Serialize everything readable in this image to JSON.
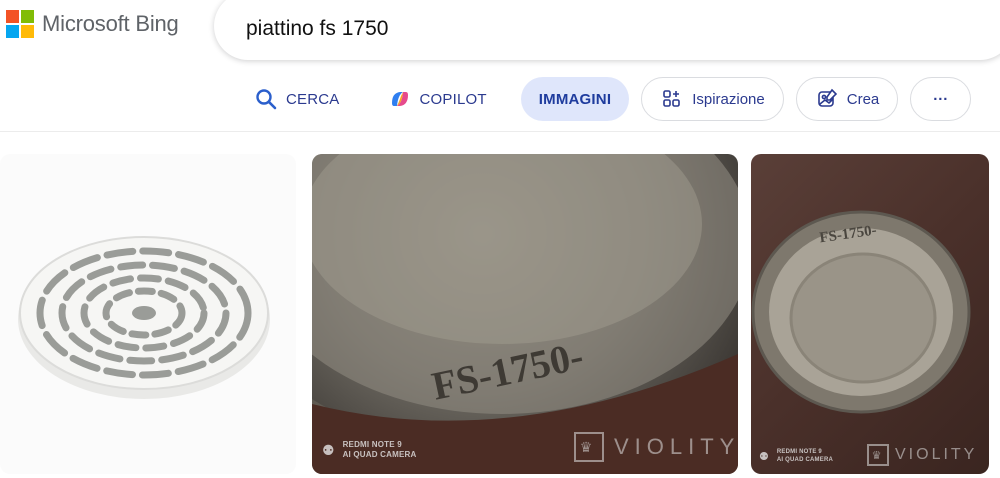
{
  "header": {
    "logo_text": "Microsoft Bing",
    "logo_colors": [
      "#f35325",
      "#81bc06",
      "#05a6f0",
      "#ffba08"
    ],
    "search_value": "piattino fs 1750"
  },
  "tabs": [
    {
      "label": "CERCA",
      "icon": "search-icon"
    },
    {
      "label": "COPILOT",
      "icon": "copilot-icon"
    },
    {
      "label": "IMMAGINI",
      "icon": "",
      "active": true
    },
    {
      "label": "Ispirazione",
      "icon": "inspiration-icon"
    },
    {
      "label": "Crea",
      "icon": "create-image-icon"
    },
    {
      "label": "···",
      "icon": "more-icon"
    }
  ],
  "colors": {
    "tab_text": "#2b3a8f",
    "active_tab_bg": "#dfe6fb"
  },
  "results": {
    "image2": {
      "engraving": "FS-1750-",
      "camera_line1": "REDMI NOTE 9",
      "camera_line2": "AI QUAD CAMERA",
      "watermark": "VIOLITY"
    },
    "image3": {
      "engraving": "FS-1750-",
      "camera_line1": "REDMI NOTE 9",
      "camera_line2": "AI QUAD CAMERA",
      "watermark": "VIOLITY"
    }
  }
}
